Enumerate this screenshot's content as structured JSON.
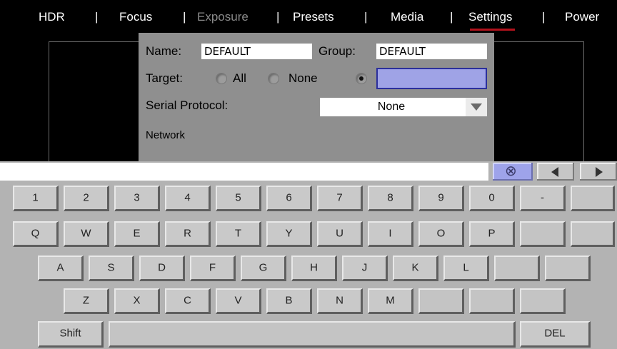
{
  "menu": {
    "items": [
      {
        "label": "HDR",
        "state": "normal"
      },
      {
        "label": "Focus",
        "state": "normal"
      },
      {
        "label": "Exposure",
        "state": "disabled"
      },
      {
        "label": "Presets",
        "state": "normal"
      },
      {
        "label": "Media",
        "state": "normal"
      },
      {
        "label": "Settings",
        "state": "active"
      },
      {
        "label": "Power",
        "state": "normal"
      }
    ],
    "separator": "|",
    "active_underline_color": "#b3121c"
  },
  "settings_panel": {
    "name_label": "Name:",
    "name_value": "DEFAULT",
    "group_label": "Group:",
    "group_value": "DEFAULT",
    "target_label": "Target:",
    "target_options": [
      {
        "label": "All",
        "selected": false
      },
      {
        "label": "None",
        "selected": false
      },
      {
        "label": "",
        "selected": true
      }
    ],
    "target_custom_value": "",
    "serial_protocol_label": "Serial Protocol:",
    "serial_protocol_value": "None",
    "network_label": "Network"
  },
  "keyboard": {
    "input_value": "",
    "clear_icon": "clear-circle-x-icon",
    "clear_glyph": "⊗",
    "rows": [
      [
        "1",
        "2",
        "3",
        "4",
        "5",
        "6",
        "7",
        "8",
        "9",
        "0",
        "-",
        ""
      ],
      [
        "Q",
        "W",
        "E",
        "R",
        "T",
        "Y",
        "U",
        "I",
        "O",
        "P",
        "",
        ""
      ],
      [
        "A",
        "S",
        "D",
        "F",
        "G",
        "H",
        "J",
        "K",
        "L",
        "",
        ""
      ],
      [
        "Z",
        "X",
        "C",
        "V",
        "B",
        "N",
        "M",
        "",
        "",
        ""
      ]
    ],
    "shift_label": "Shift",
    "space_label": "",
    "del_label": "DEL"
  }
}
